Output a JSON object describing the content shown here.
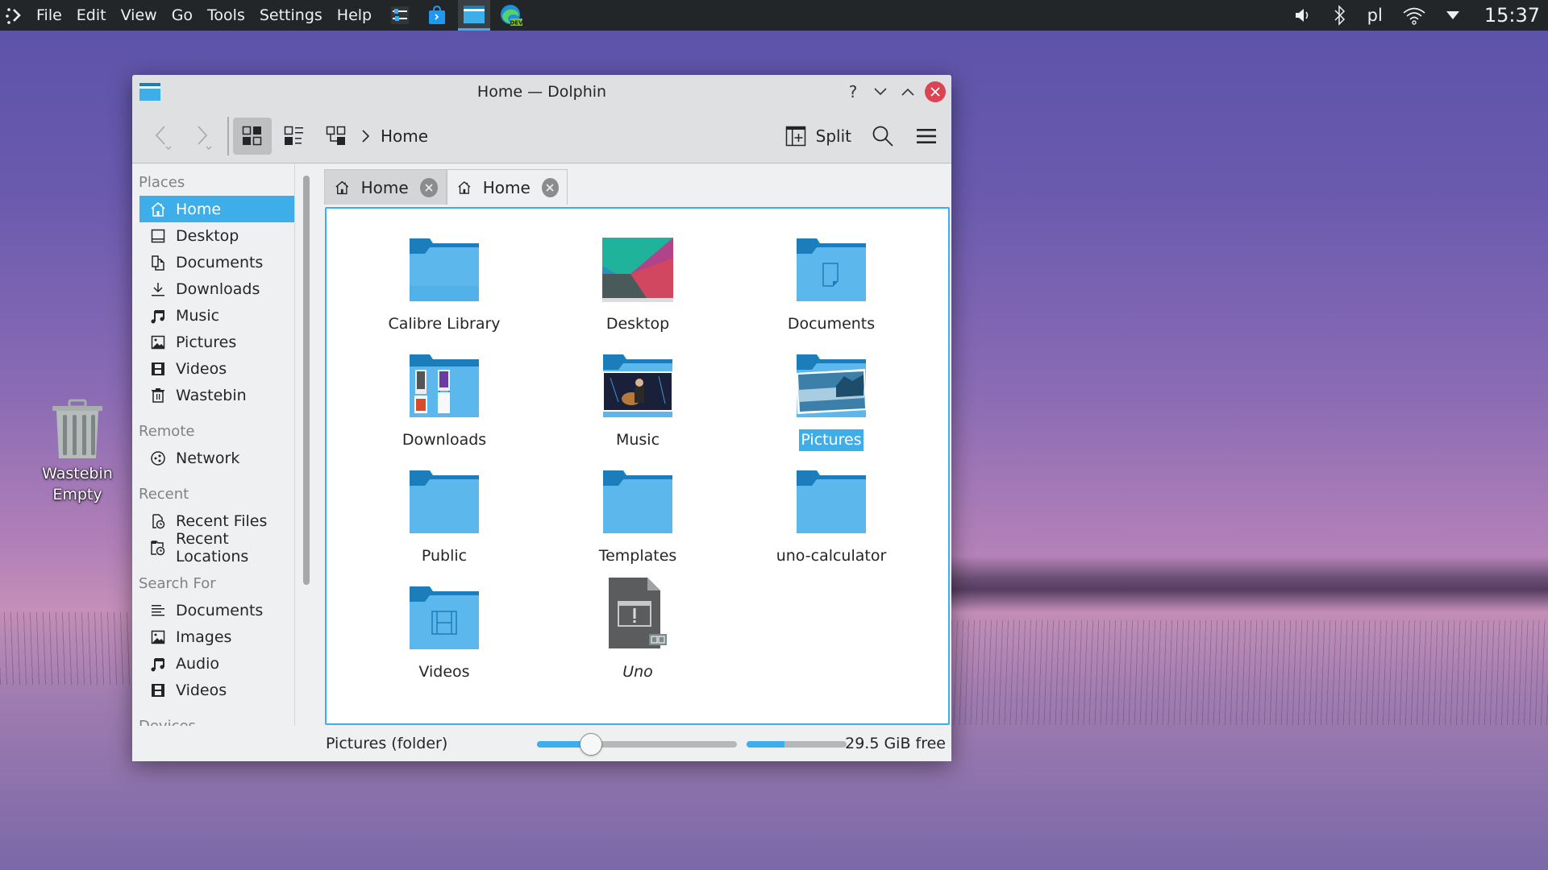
{
  "panel": {
    "menu": [
      "File",
      "Edit",
      "View",
      "Go",
      "Tools",
      "Settings",
      "Help"
    ],
    "tasks": [
      {
        "name": "system-settings",
        "icon": "settings-sliders-icon"
      },
      {
        "name": "discover",
        "icon": "store-bag-icon"
      },
      {
        "name": "dolphin",
        "icon": "folder-icon",
        "active": true
      },
      {
        "name": "edge-dev",
        "icon": "edge-dev-icon",
        "badge": "DEV"
      }
    ],
    "tray": {
      "volume_icon": "speaker-icon",
      "bluetooth_icon": "bluetooth-icon",
      "keyboard_layout": "pl",
      "wifi_icon": "wifi-icon",
      "expand_icon": "triangle-down-icon",
      "clock": "15:37"
    }
  },
  "desktop": {
    "wastebin": {
      "line1": "Wastebin",
      "line2": "Empty"
    }
  },
  "window": {
    "title": "Home — Dolphin",
    "controls": {
      "help": "?",
      "minimize": "⌄",
      "maximize": "⌃",
      "close": "✕"
    },
    "toolbar": {
      "breadcrumb": "Home",
      "split_label": "Split",
      "view_mode": "icons"
    },
    "sidebar": {
      "sections": [
        {
          "heading": "Places",
          "items": [
            {
              "label": "Home",
              "icon": "home-icon",
              "selected": true
            },
            {
              "label": "Desktop",
              "icon": "desktop-icon"
            },
            {
              "label": "Documents",
              "icon": "documents-icon"
            },
            {
              "label": "Downloads",
              "icon": "download-icon"
            },
            {
              "label": "Music",
              "icon": "music-note-icon"
            },
            {
              "label": "Pictures",
              "icon": "image-icon"
            },
            {
              "label": "Videos",
              "icon": "film-icon"
            },
            {
              "label": "Wastebin",
              "icon": "trash-icon"
            }
          ]
        },
        {
          "heading": "Remote",
          "items": [
            {
              "label": "Network",
              "icon": "network-icon"
            }
          ]
        },
        {
          "heading": "Recent",
          "items": [
            {
              "label": "Recent Files",
              "icon": "recent-files-icon"
            },
            {
              "label": "Recent Locations",
              "icon": "recent-locations-icon"
            }
          ]
        },
        {
          "heading": "Search For",
          "items": [
            {
              "label": "Documents",
              "icon": "text-lines-icon"
            },
            {
              "label": "Images",
              "icon": "image-icon"
            },
            {
              "label": "Audio",
              "icon": "music-note-icon"
            },
            {
              "label": "Videos",
              "icon": "film-icon"
            }
          ]
        },
        {
          "heading": "Devices",
          "items": []
        }
      ]
    },
    "tabs": [
      {
        "label": "Home",
        "active": false
      },
      {
        "label": "Home",
        "active": true
      }
    ],
    "items": [
      {
        "name": "Calibre Library",
        "type": "folder"
      },
      {
        "name": "Desktop",
        "type": "desktop-thumb"
      },
      {
        "name": "Documents",
        "type": "folder-documents"
      },
      {
        "name": "Downloads",
        "type": "folder-downloads"
      },
      {
        "name": "Music",
        "type": "folder-music"
      },
      {
        "name": "Pictures",
        "type": "folder-pictures",
        "selected": true
      },
      {
        "name": "Public",
        "type": "folder"
      },
      {
        "name": "Templates",
        "type": "folder"
      },
      {
        "name": "uno-calculator",
        "type": "folder"
      },
      {
        "name": "Videos",
        "type": "folder-videos"
      },
      {
        "name": "Uno",
        "type": "broken-link",
        "italic": true
      }
    ],
    "status": {
      "selection_text": "Pictures (folder)",
      "zoom_level_fraction": 0.27,
      "disk_used_fraction": 0.38,
      "free_space": "29.5 GiB free"
    }
  },
  "colors": {
    "accent": "#3daee9",
    "close_button": "#da4453",
    "panel_bg": "#232629",
    "window_bg": "#eff0f1",
    "folder_light": "#5cb8ec",
    "folder_dark": "#1b7dba"
  }
}
